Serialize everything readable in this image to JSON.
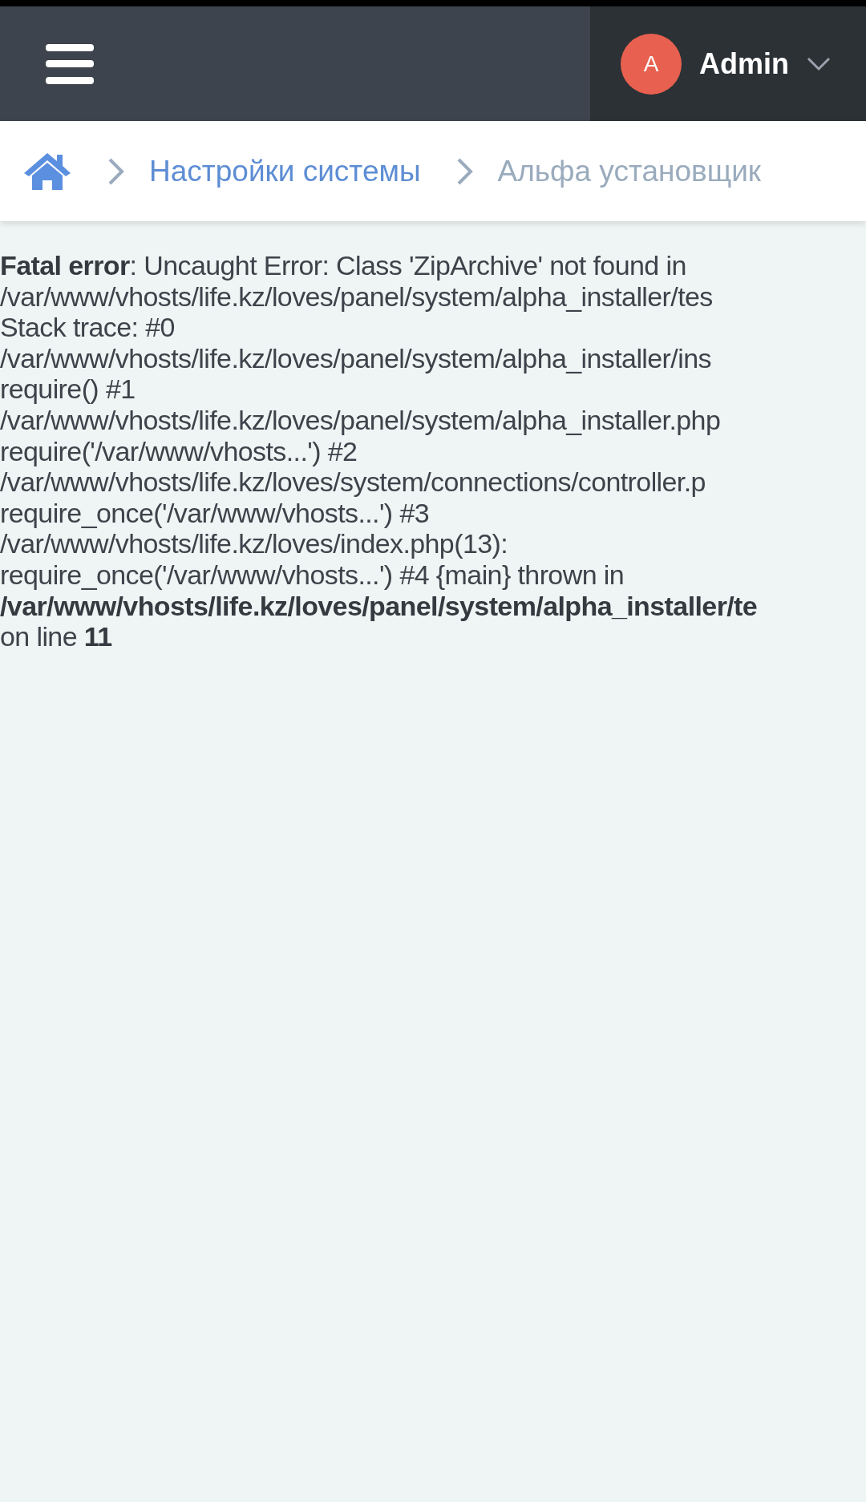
{
  "header": {
    "user": {
      "avatar_letter": "A",
      "name": "Admin"
    }
  },
  "breadcrumbs": [
    {
      "label": "Настройки системы",
      "kind": "link"
    },
    {
      "label": "Альфа установщик",
      "kind": "current"
    }
  ],
  "error_lines": [
    {
      "text": "**Fatal error**: Uncaught Error: Class 'ZipArchive' not found in"
    },
    {
      "text": "/var/www/vhosts/life.kz/loves/panel/system/alpha_installer/tes"
    },
    {
      "text": "Stack trace: #0"
    },
    {
      "text": "/var/www/vhosts/life.kz/loves/panel/system/alpha_installer/ins"
    },
    {
      "text": "require() #1"
    },
    {
      "text": "/var/www/vhosts/life.kz/loves/panel/system/alpha_installer.php"
    },
    {
      "text": "require('/var/www/vhosts...') #2"
    },
    {
      "text": "/var/www/vhosts/life.kz/loves/system/connections/controller.p"
    },
    {
      "text": "require_once('/var/www/vhosts...') #3"
    },
    {
      "text": "/var/www/vhosts/life.kz/loves/index.php(13):"
    },
    {
      "text": "require_once('/var/www/vhosts...') #4 {main} thrown in"
    },
    {
      "text": "**/var/www/vhosts/life.kz/loves/panel/system/alpha_installer/te**"
    },
    {
      "text": "on line **11**"
    }
  ]
}
